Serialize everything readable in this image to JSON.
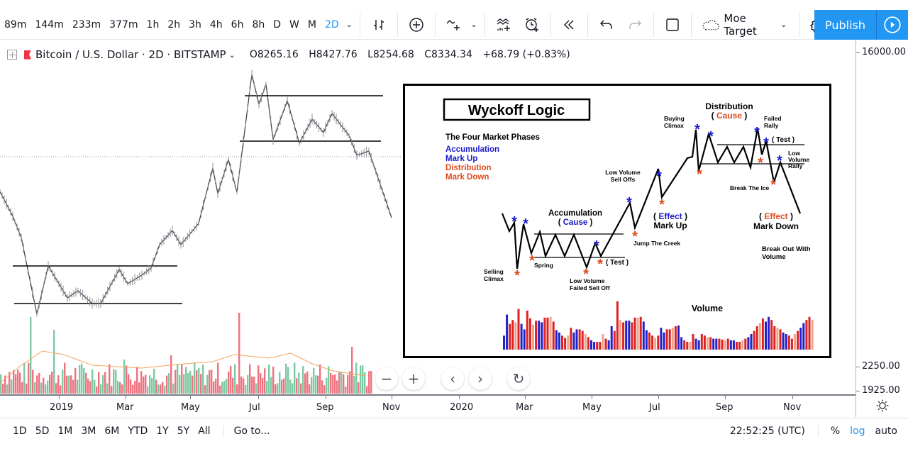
{
  "toolbar": {
    "intervals": [
      "89m",
      "144m",
      "233m",
      "377m",
      "1h",
      "2h",
      "3h",
      "4h",
      "6h",
      "8h",
      "D",
      "W",
      "M",
      "2D"
    ],
    "active_interval": "2D",
    "icons": [
      "bar-style-icon",
      "compare-icon",
      "indicators-icon",
      "financials-icon",
      "alert-icon",
      "replay-icon",
      "undo-icon",
      "redo-icon",
      "layout-icon",
      "cloud-icon",
      "settings-icon",
      "fullscreen-icon",
      "camera-icon"
    ],
    "layout_name": "Moe Target",
    "publish_label": "Publish"
  },
  "legend": {
    "symbol": "Bitcoin / U.S. Dollar · 2D · BITSTAMP",
    "open": "O8265.16",
    "high": "H8427.76",
    "low": "L8254.68",
    "close": "C8334.34",
    "change": "+68.79 (+0.83%)"
  },
  "price_axis": {
    "labels": [
      "16000.00",
      "2250.00",
      "1925.00"
    ]
  },
  "time_axis": {
    "labels": [
      "2019",
      "Mar",
      "May",
      "Jul",
      "Sep",
      "Nov",
      "2020",
      "Mar",
      "May",
      "Jul",
      "Sep",
      "Nov"
    ]
  },
  "nav_buttons": [
    "−",
    "+",
    "‹",
    "›",
    "↻"
  ],
  "bottom_bar": {
    "ranges": [
      "1D",
      "5D",
      "1M",
      "3M",
      "6M",
      "YTD",
      "1Y",
      "5Y",
      "All"
    ],
    "goto": "Go to...",
    "clock": "22:52:25 (UTC)",
    "percent": "%",
    "log": "log",
    "auto": "auto"
  },
  "wyckoff": {
    "title": "Wyckoff Logic",
    "phases_heading": "The Four Market Phases",
    "phases": [
      {
        "label": "Accumulation",
        "color": "#1a1acc"
      },
      {
        "label": "Mark Up",
        "color": "#1a1acc"
      },
      {
        "label": "Distribution",
        "color": "#e04a1a"
      },
      {
        "label": "Mark Down",
        "color": "#e04a1a"
      }
    ],
    "accumulation": "Accumulation",
    "accumulation_cause": "Cause",
    "distribution": "Distribution",
    "distribution_cause": "Cause",
    "markup_effect": "Effect",
    "markup": "Mark Up",
    "markdown_effect": "Effect",
    "markdown": "Mark Down",
    "annotations": {
      "selling_climax": [
        "Selling",
        "Climax"
      ],
      "spring": "Spring",
      "test": "( Test )",
      "lvfso": [
        "Low Volume",
        "Failed Sell Off"
      ],
      "jump_creek": "Jump The Creek",
      "lv_sell_offs": [
        "Low Volume",
        "Sell Offs"
      ],
      "buying_climax": [
        "Buying",
        "Climax"
      ],
      "failed_rally": [
        "Failed",
        "Rally"
      ],
      "test2": "( Test )",
      "lv_rally": [
        "Low",
        "Volume",
        "Rally"
      ],
      "break_ice": "Break The Ice",
      "breakout": [
        "Break Out With",
        "Volume"
      ]
    },
    "volume_label": "Volume"
  },
  "colors": {
    "accent": "#2196f3",
    "bull_volume": "#7ccaa3",
    "bear_volume": "#ef7280",
    "blue_star": "#1a1acc",
    "red_star": "#e04a1a"
  }
}
